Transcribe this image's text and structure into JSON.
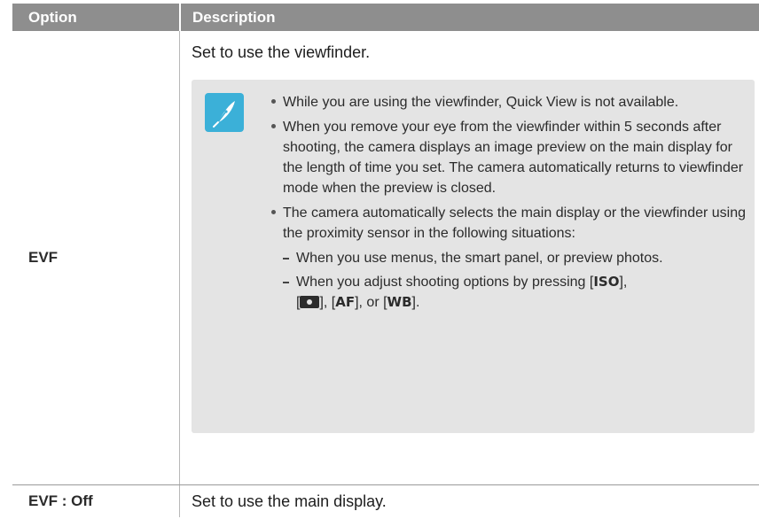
{
  "header": {
    "col_option": "Option",
    "col_description": "Description"
  },
  "rows": [
    {
      "option": "EVF",
      "description": "Set to use the viewfinder.",
      "note": {
        "icon": "note-pen-icon",
        "bullet1": "While you are using the viewfinder, Quick View is not available.",
        "bullet2": "When you remove your eye from the viewfinder within 5 seconds after shooting, the camera displays an image preview on the main display for the length of time you set. The camera automatically returns to viewfinder mode when the preview is closed.",
        "bullet3": "The camera automatically selects the main display or the viewfinder using the proximity sensor in the following situations:",
        "sub1": "When you use menus, the smart panel, or preview photos.",
        "sub2": {
          "pre": "When you adjust shooting options by pressing [",
          "iso": "ISO",
          "mid1": "],",
          "mid1b": "[",
          "mid2": "], [",
          "af": "AF",
          "mid3": "], or [",
          "wb": "WB",
          "post": "]."
        }
      }
    },
    {
      "option": "EVF : Off",
      "description": "Set to use the main display."
    }
  ],
  "colors": {
    "header_bg": "#8e8e8e",
    "note_bg": "#e4e4e4",
    "icon_bg": "#3bb0d8"
  }
}
